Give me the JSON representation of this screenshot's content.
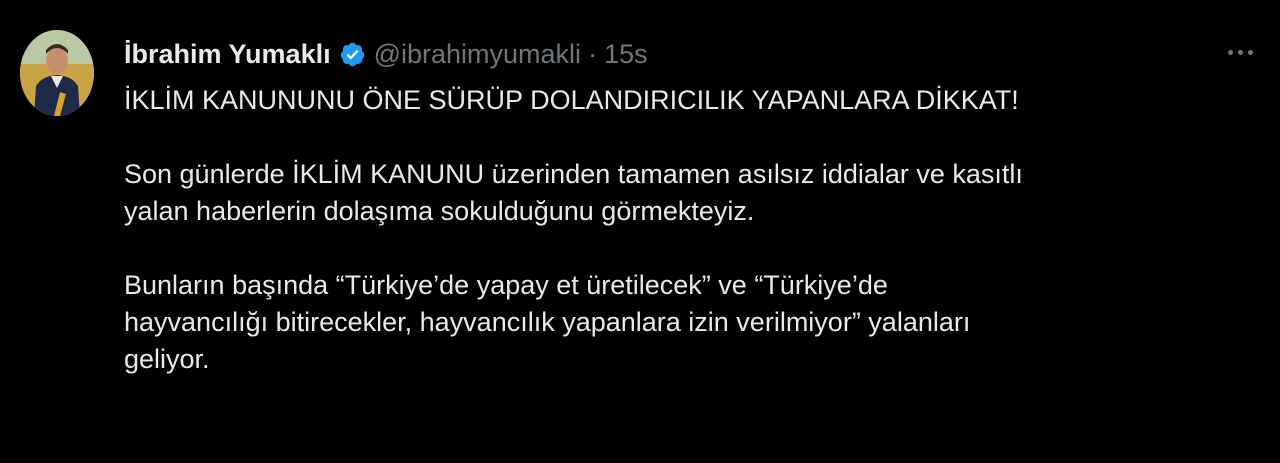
{
  "tweet": {
    "author": {
      "display_name": "İbrahim Yumaklı",
      "handle": "@ibrahimyumakli",
      "verified_icon": "verified-badge-icon",
      "verified_color": "#1d9bf0"
    },
    "separator": "·",
    "timestamp": "15s",
    "more_icon": "more-options-icon",
    "body": {
      "headline": "İKLİM KANUNUNU ÖNE SÜRÜP DOLANDIRICILIK YAPANLARA DİKKAT!",
      "paragraph1": {
        "line1": "Son günlerde İKLİM KANUNU üzerinden tamamen asılsız iddialar ve kasıtlı",
        "line2": "yalan haberlerin dolaşıma sokulduğunu görmekteyiz."
      },
      "paragraph2": {
        "line1": "Bunların başında “Türkiye’de yapay et üretilecek” ve “Türkiye’de",
        "line2": "hayvancılığı bitirecekler, hayvancılık yapanlara izin verilmiyor” yalanları",
        "line3": "geliyor."
      }
    }
  }
}
